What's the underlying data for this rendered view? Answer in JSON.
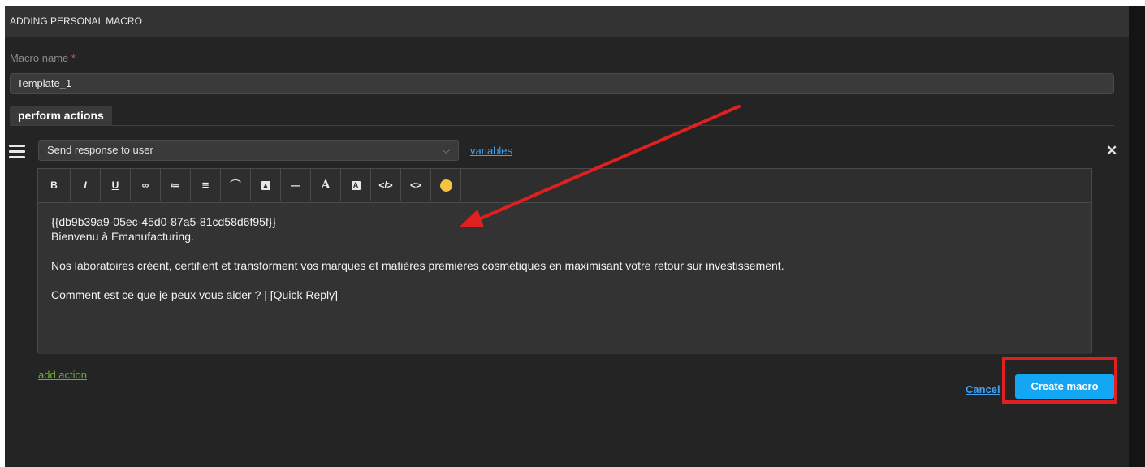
{
  "header": {
    "title": "ADDING PERSONAL MACRO"
  },
  "macro_name": {
    "label": "Macro name",
    "required_mark": "*",
    "value": "Template_1"
  },
  "tabs": [
    {
      "label": "perform actions"
    }
  ],
  "action": {
    "selected_action": "Send response to user",
    "variables_link": "variables",
    "close_icon": "close-icon",
    "toolbar": [
      {
        "name": "bold-button",
        "glyph": "B"
      },
      {
        "name": "italic-button",
        "glyph": "I"
      },
      {
        "name": "underline-button",
        "glyph": "U"
      },
      {
        "name": "link-button",
        "glyph": "⊂⊃"
      },
      {
        "name": "ordered-list-button",
        "glyph": "≔"
      },
      {
        "name": "bullet-list-button",
        "glyph": "≡"
      },
      {
        "name": "attachment-button",
        "glyph": "🖇"
      },
      {
        "name": "image-button",
        "glyph": "▣"
      },
      {
        "name": "horizontal-rule-button",
        "glyph": "—"
      },
      {
        "name": "text-color-button",
        "glyph": "A"
      },
      {
        "name": "background-color-button",
        "glyph": "A"
      },
      {
        "name": "code-block-button",
        "glyph": "</>"
      },
      {
        "name": "inline-code-button",
        "glyph": "<>"
      },
      {
        "name": "emoji-button",
        "glyph": ""
      }
    ],
    "content": {
      "line1": "{{db9b39a9-05ec-45d0-87a5-81cd58d6f95f}}",
      "line2": "Bienvenu à Emanufacturing.",
      "line3": "Nos laboratoires créent, certifient et transforment vos marques et matières premières cosmétiques en maximisant votre retour sur investissement.",
      "line4": "Comment est ce que je peux vous aider ? | [Quick Reply]"
    }
  },
  "footer": {
    "add_action": "add action",
    "cancel": "Cancel",
    "create": "Create macro"
  },
  "colors": {
    "accent": "#13a6f3",
    "link": "#3fa3f5",
    "add_action": "#6fae3a",
    "annotation": "#e02020"
  }
}
